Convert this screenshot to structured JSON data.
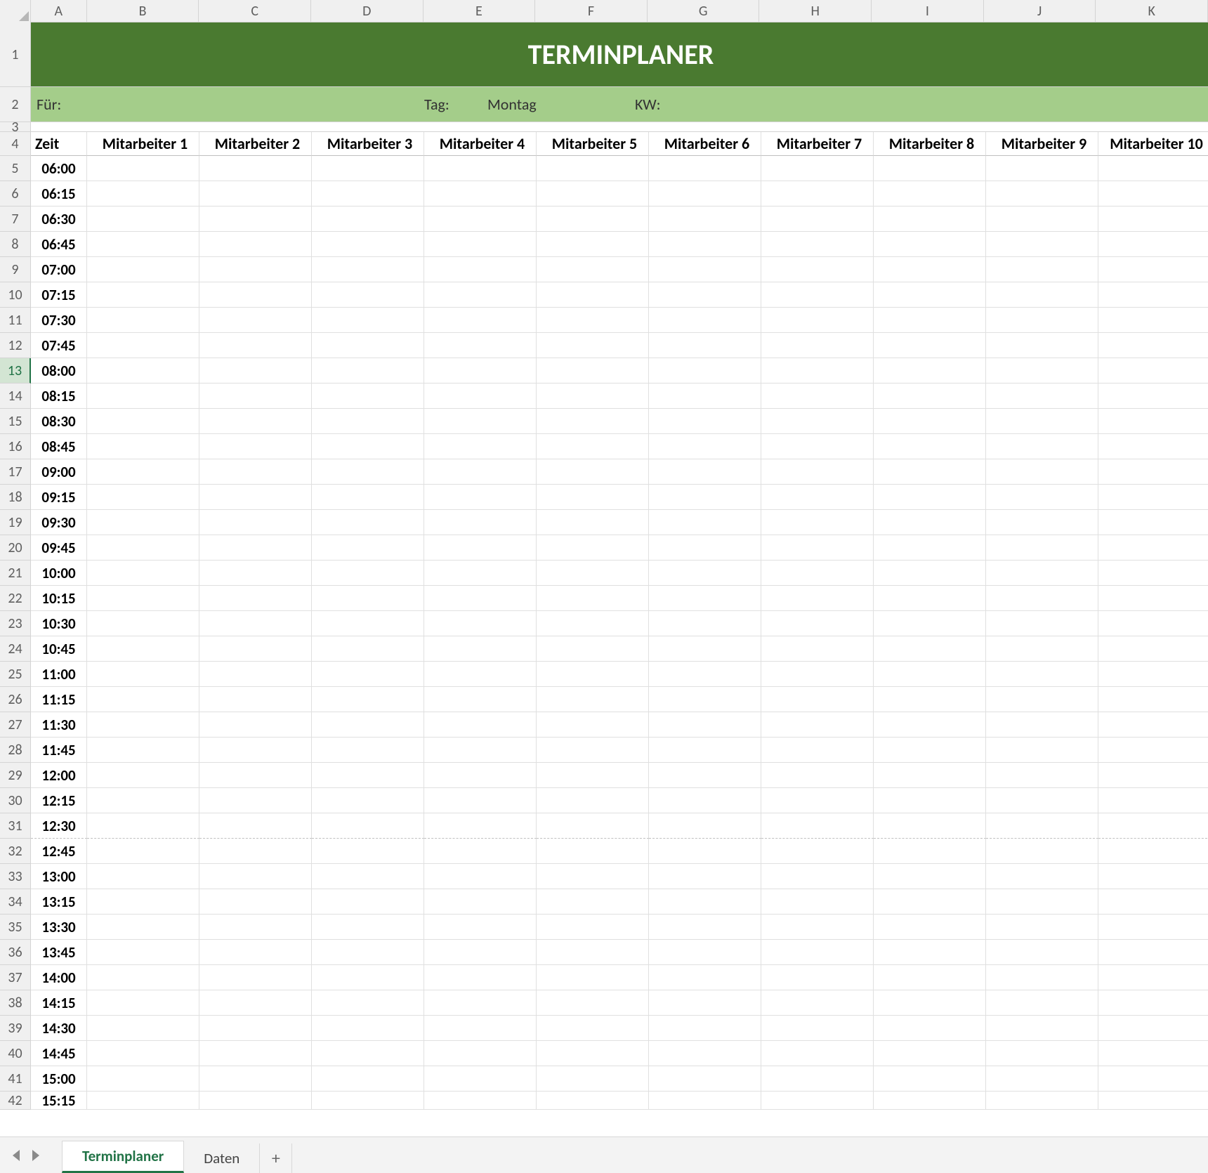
{
  "columns": [
    "A",
    "B",
    "C",
    "D",
    "E",
    "F",
    "G",
    "H",
    "I",
    "J",
    "K"
  ],
  "title": "TERMINPLANER",
  "info": {
    "fuer_label": "Für:",
    "fuer_value": "",
    "tag_label": "Tag:",
    "tag_value": "Montag",
    "kw_label": "KW:",
    "kw_value": ""
  },
  "header": {
    "zeit": "Zeit",
    "cols": [
      "Mitarbeiter 1",
      "Mitarbeiter 2",
      "Mitarbeiter 3",
      "Mitarbeiter 4",
      "Mitarbeiter 5",
      "Mitarbeiter 6",
      "Mitarbeiter 7",
      "Mitarbeiter 8",
      "Mitarbeiter 9",
      "Mitarbeiter 10"
    ]
  },
  "times": [
    "06:00",
    "06:15",
    "06:30",
    "06:45",
    "07:00",
    "07:15",
    "07:30",
    "07:45",
    "08:00",
    "08:15",
    "08:30",
    "08:45",
    "09:00",
    "09:15",
    "09:30",
    "09:45",
    "10:00",
    "10:15",
    "10:30",
    "10:45",
    "11:00",
    "11:15",
    "11:30",
    "11:45",
    "12:00",
    "12:15",
    "12:30",
    "12:45",
    "13:00",
    "13:15",
    "13:30",
    "13:45",
    "14:00",
    "14:15",
    "14:30",
    "14:45",
    "15:00",
    "15:15"
  ],
  "row_headers": {
    "r1": "1",
    "r2": "2",
    "r3": "3",
    "r4": "4"
  },
  "selected_row_header": "13",
  "pagebreak_after_row": 31,
  "sheet_tabs": {
    "active": "Terminplaner",
    "others": [
      "Daten"
    ],
    "add_label": "+"
  },
  "colors": {
    "title_bg": "#4a7a30",
    "info_bg": "#a4cd8a",
    "accent": "#217346"
  }
}
